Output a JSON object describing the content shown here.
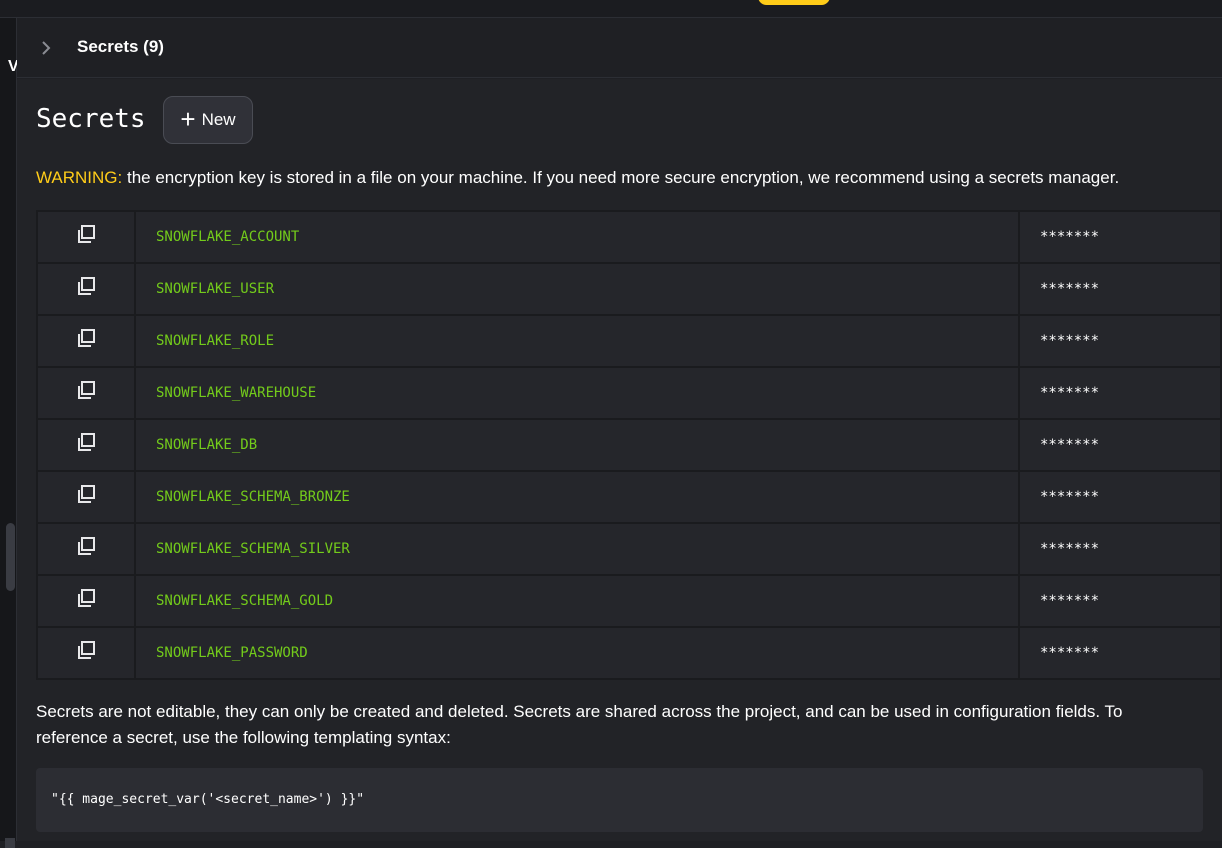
{
  "breadcrumb": {
    "label": "Secrets (9)",
    "rail_letter": "V"
  },
  "page": {
    "title": "Secrets",
    "new_button_label": "New",
    "warning_label": "WARNING:",
    "warning_text": " the encryption key is stored in a file on your machine. If you need more secure encryption, we recommend using a secrets manager.",
    "footnote": "Secrets are not editable, they can only be created and deleted. Secrets are shared across the project, and can be used in configuration fields. To reference a secret, use the following templating syntax:",
    "code_sample": "\"{{ mage_secret_var('<secret_name>') }}\""
  },
  "secrets": [
    {
      "name": "SNOWFLAKE_ACCOUNT",
      "value": "*******"
    },
    {
      "name": "SNOWFLAKE_USER",
      "value": "*******"
    },
    {
      "name": "SNOWFLAKE_ROLE",
      "value": "*******"
    },
    {
      "name": "SNOWFLAKE_WAREHOUSE",
      "value": "*******"
    },
    {
      "name": "SNOWFLAKE_DB",
      "value": "*******"
    },
    {
      "name": "SNOWFLAKE_SCHEMA_BRONZE",
      "value": "*******"
    },
    {
      "name": "SNOWFLAKE_SCHEMA_SILVER",
      "value": "*******"
    },
    {
      "name": "SNOWFLAKE_SCHEMA_GOLD",
      "value": "*******"
    },
    {
      "name": "SNOWFLAKE_PASSWORD",
      "value": "*******"
    }
  ],
  "icons": {
    "breadcrumb_separator": "chevron-right-icon",
    "new_button": "plus-icon",
    "row_action": "copy-icon"
  },
  "colors": {
    "accent_yellow": "#ffcc19",
    "secret_name_green": "#73cb1b",
    "background": "#222327"
  }
}
